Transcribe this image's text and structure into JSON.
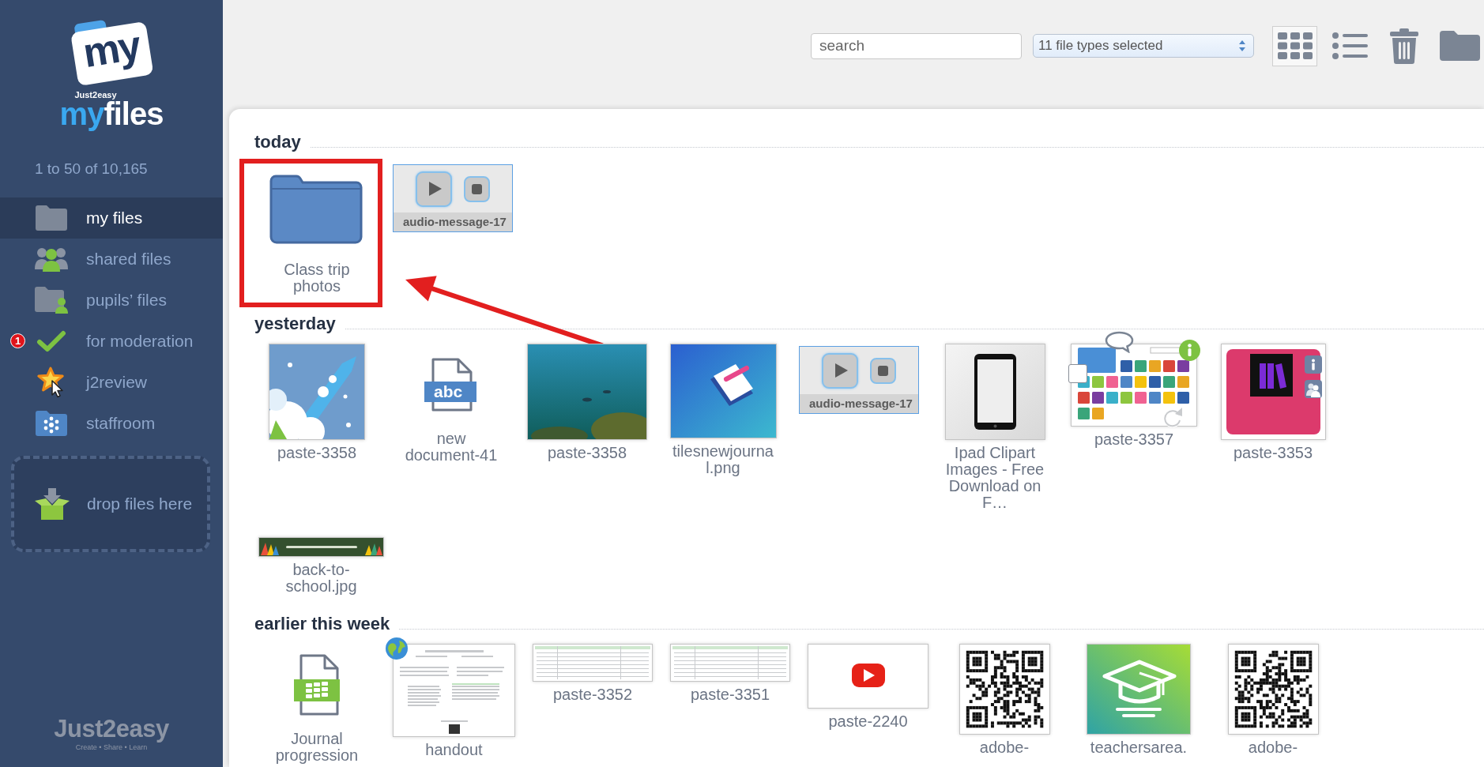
{
  "sidebar": {
    "logo": {
      "badge": "my",
      "brand": "Just2easy",
      "wordmark": [
        "my",
        "files"
      ]
    },
    "counter": "1 to 50 of 10,165",
    "nav": [
      {
        "label": "my files",
        "kind": "folder",
        "selected": true
      },
      {
        "label": "shared files",
        "kind": "shared",
        "selected": false
      },
      {
        "label": "pupils’ files",
        "kind": "pupils",
        "selected": false
      },
      {
        "label": "for moderation",
        "kind": "moderation",
        "selected": false,
        "badge": "1"
      },
      {
        "label": "j2review",
        "kind": "review",
        "selected": false
      },
      {
        "label": "staffroom",
        "kind": "staffroom",
        "selected": false
      }
    ],
    "drop_zone": "drop files here",
    "footer": {
      "brand": "Just2easy",
      "tagline": "Create • Share • Learn"
    }
  },
  "toolbar": {
    "search": {
      "placeholder": "search"
    },
    "filter": "11 file types selected",
    "views": [
      {
        "kind": "grid",
        "selected": true
      },
      {
        "kind": "list",
        "selected": false
      }
    ]
  },
  "sections": [
    {
      "title": "today",
      "files": [
        {
          "name": "Class trip photos",
          "kind": "folder",
          "highlighted": true
        },
        {
          "name": "audio-message-17",
          "kind": "audio"
        }
      ]
    },
    {
      "title": "yesterday",
      "files": [
        {
          "name": "paste-3358",
          "kind": "rocket"
        },
        {
          "name": "new document-41",
          "kind": "document",
          "icon_text": "abc"
        },
        {
          "name": "paste-3358",
          "kind": "underwater"
        },
        {
          "name": "tilesnewjournal.png",
          "kind": "journal"
        },
        {
          "name": "audio-message-17",
          "kind": "audio"
        },
        {
          "name": "Ipad Clipart Images - Free Download on F…",
          "kind": "tablet"
        },
        {
          "name": "paste-3357",
          "kind": "screenshot",
          "hovered": true,
          "checked": false
        },
        {
          "name": "paste-3353",
          "kind": "poster",
          "shared": true
        },
        {
          "name": "back-to-school.jpg",
          "kind": "banner"
        }
      ]
    },
    {
      "title": "earlier this week",
      "files": [
        {
          "name": "Journal progression",
          "kind": "spreadsheet"
        },
        {
          "name": "handout",
          "kind": "handout",
          "published": true
        },
        {
          "name": "paste-3352",
          "kind": "table"
        },
        {
          "name": "paste-3351",
          "kind": "table"
        },
        {
          "name": "paste-2240",
          "kind": "video"
        },
        {
          "name": "adobe-",
          "kind": "qr"
        },
        {
          "name": "teachersarea.",
          "kind": "graduation"
        },
        {
          "name": "adobe-",
          "kind": "qr"
        }
      ]
    }
  ]
}
